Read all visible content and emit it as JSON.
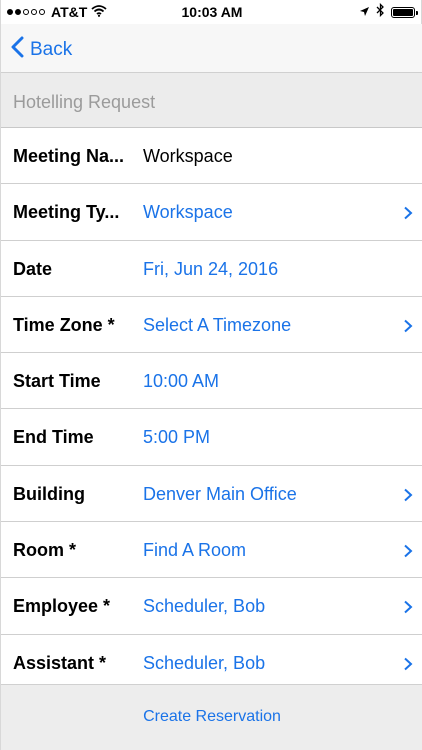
{
  "status_bar": {
    "carrier": "AT&T",
    "time": "10:03 AM",
    "signal_dots_filled": 2,
    "signal_dots_total": 5
  },
  "nav": {
    "back_label": "Back"
  },
  "section": {
    "title": "Hotelling Request"
  },
  "rows": [
    {
      "label": "Meeting Na...",
      "value": "Workspace",
      "value_style": "dark",
      "has_chevron": false
    },
    {
      "label": "Meeting Ty...",
      "value": "Workspace",
      "value_style": "link",
      "has_chevron": true
    },
    {
      "label": "Date",
      "value": "Fri, Jun 24, 2016",
      "value_style": "link",
      "has_chevron": false
    },
    {
      "label": "Time Zone *",
      "value": "Select A Timezone",
      "value_style": "link",
      "has_chevron": true
    },
    {
      "label": "Start Time",
      "value": "10:00 AM",
      "value_style": "link",
      "has_chevron": false
    },
    {
      "label": "End Time",
      "value": "5:00 PM",
      "value_style": "link",
      "has_chevron": false
    },
    {
      "label": "Building",
      "value": "Denver Main Office",
      "value_style": "link",
      "has_chevron": true
    },
    {
      "label": "Room *",
      "value": "Find A Room",
      "value_style": "link",
      "has_chevron": true
    },
    {
      "label": "Employee *",
      "value": "Scheduler, Bob",
      "value_style": "link",
      "has_chevron": true
    },
    {
      "label": "Assistant *",
      "value": "Scheduler, Bob",
      "value_style": "link",
      "has_chevron": true
    }
  ],
  "footer": {
    "create_label": "Create Reservation"
  },
  "colors": {
    "accent": "#1a73e8",
    "header_bg": "#ececec",
    "nav_bg": "#f7f7f7"
  },
  "icons": {
    "back": "chevron-left-icon",
    "row_disclosure": "chevron-right-icon",
    "wifi": "wifi-icon",
    "location": "location-arrow-icon",
    "bluetooth": "bluetooth-icon",
    "battery": "battery-icon"
  }
}
